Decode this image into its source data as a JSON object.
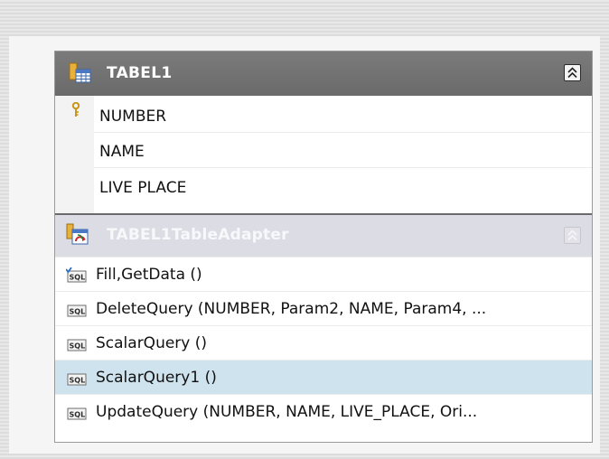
{
  "table": {
    "title": "TABEL1",
    "icon": "table-icon",
    "collapse_icon": "collapse-up-icon",
    "columns": [
      {
        "name": "NUMBER",
        "primary_key": true
      },
      {
        "name": "NAME",
        "primary_key": false
      },
      {
        "name": "LIVE PLACE",
        "primary_key": false
      }
    ]
  },
  "adapter": {
    "title": "TABEL1TableAdapter",
    "icon": "table-adapter-icon",
    "collapse_icon": "collapse-up-icon",
    "queries": [
      {
        "label": "Fill,GetData ()",
        "icon": "sql-default-query-icon",
        "selected": false
      },
      {
        "label": "DeleteQuery (NUMBER, Param2, NAME, Param4, ...",
        "icon": "sql-query-icon",
        "selected": false
      },
      {
        "label": "ScalarQuery ()",
        "icon": "sql-query-icon",
        "selected": false
      },
      {
        "label": "ScalarQuery1 ()",
        "icon": "sql-query-icon",
        "selected": true
      },
      {
        "label": "UpdateQuery (NUMBER, NAME, LIVE_PLACE, Ori...",
        "icon": "sql-query-icon",
        "selected": false
      }
    ]
  },
  "colors": {
    "header_bg": "#6f6f6f",
    "adapter_header_bg": "#dcdde4",
    "selected_row_bg": "#cfe3ee"
  }
}
